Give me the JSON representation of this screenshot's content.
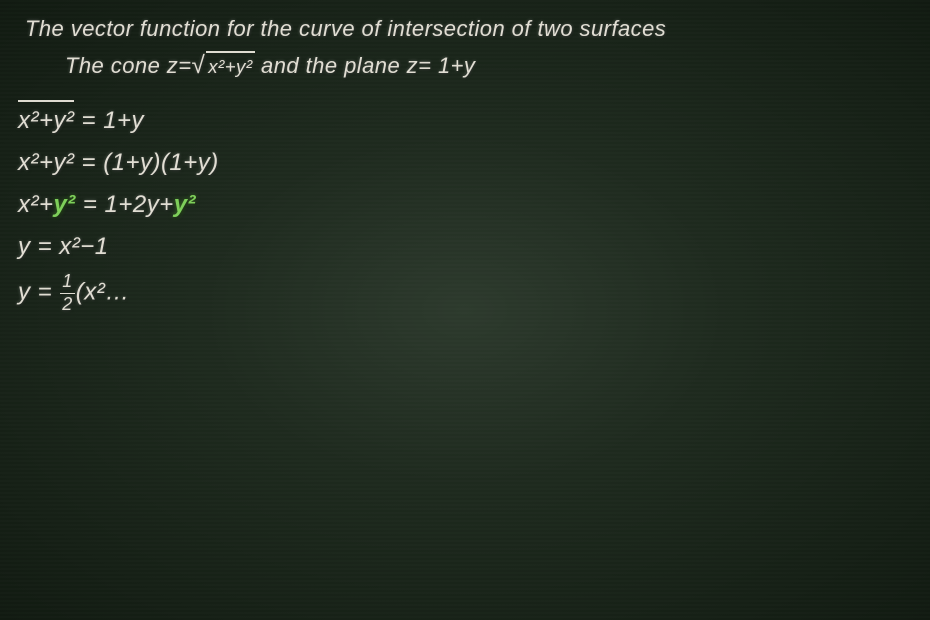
{
  "board": {
    "title_line1": "The vector function for the curve of intersection of two surfaces",
    "title_line2_part1": "The cone z=",
    "title_line2_sqrt": "x²+y²",
    "title_line2_part2": " and the plane z= 1+y",
    "equations": [
      {
        "id": "eq1",
        "display": "√(x²+y²) = 1+y",
        "parts": [
          "overline_x2y2",
          " = 1+y"
        ]
      },
      {
        "id": "eq2",
        "display": "x²+y² = (1+y)(1+y)"
      },
      {
        "id": "eq3",
        "display": "x²+y² = 1+2y+y² (with crossed y²)"
      },
      {
        "id": "eq4",
        "display": "y = x²-1"
      },
      {
        "id": "eq5",
        "display": "y = ½(x²..."
      }
    ],
    "accent_color": "#7ecf5a"
  }
}
